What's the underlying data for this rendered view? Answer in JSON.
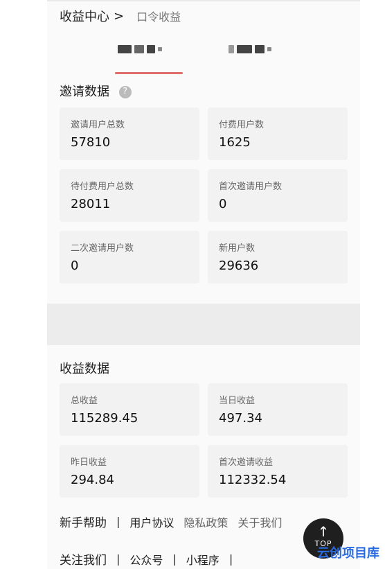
{
  "header": {
    "title": "收益中心",
    "chevron": ">",
    "subtitle": "口令收益"
  },
  "tabs": [
    {
      "label": ""
    },
    {
      "label": ""
    }
  ],
  "invite": {
    "title": "邀请数据",
    "help": "?",
    "cards": [
      {
        "label": "邀请用户总数",
        "value": "57810"
      },
      {
        "label": "付费用户数",
        "value": "1625"
      },
      {
        "label": "待付费用户总数",
        "value": "28011"
      },
      {
        "label": "首次邀请用户数",
        "value": "0"
      },
      {
        "label": "二次邀请用户数",
        "value": "0"
      },
      {
        "label": "新用户数",
        "value": "29636"
      }
    ]
  },
  "earnings": {
    "title": "收益数据",
    "cards": [
      {
        "label": "总收益",
        "value": "115289.45"
      },
      {
        "label": "当日收益",
        "value": "497.34"
      },
      {
        "label": "昨日收益",
        "value": "294.84"
      },
      {
        "label": "首次邀请收益",
        "value": "112332.54"
      }
    ]
  },
  "footer": {
    "row1": {
      "head": "新手帮助",
      "sep": "|",
      "items": [
        "用户协议",
        "隐私政策",
        "关于我们"
      ]
    },
    "row2": {
      "head": "关注我们",
      "sep": "|",
      "items": [
        "公众号",
        "小程序"
      ]
    }
  },
  "top_button": {
    "arrow": "↑",
    "text": "TOP"
  },
  "watermark": "云创项目库"
}
